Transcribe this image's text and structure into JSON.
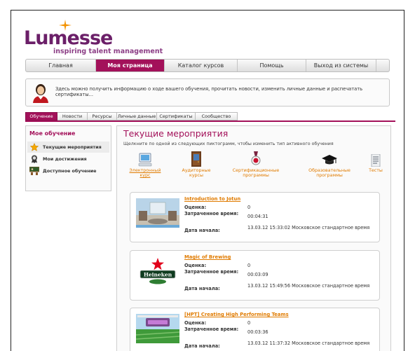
{
  "brand": {
    "name": "Lumesse",
    "tagline": "inspiring talent management",
    "color": "#6b1f68"
  },
  "topnav": [
    {
      "label": "Главная",
      "active": false
    },
    {
      "label": "Моя страница",
      "active": true
    },
    {
      "label": "Каталог курсов",
      "active": false
    },
    {
      "label": "Помощь",
      "active": false
    },
    {
      "label": "Выход из системы",
      "active": false
    }
  ],
  "info": {
    "text": "Здесь можно получить информацию о ходе вашего обучения, прочитать новости, изменить личные данные и распечатать сертификаты..."
  },
  "subtabs": [
    {
      "label": "Обучение",
      "active": true
    },
    {
      "label": "Новости",
      "active": false
    },
    {
      "label": "Ресурсы",
      "active": false
    },
    {
      "label": "Личные данные",
      "active": false
    },
    {
      "label": "Сертификаты",
      "active": false
    },
    {
      "label": "Сообщество",
      "active": false
    }
  ],
  "sidebar": {
    "title": "Мое обучение",
    "items": [
      {
        "label": "Текущие мероприятия",
        "icon": "star-icon",
        "active": true
      },
      {
        "label": "Мои достижения",
        "icon": "medal-icon",
        "active": false
      },
      {
        "label": "Доступное обучение",
        "icon": "classroom-icon",
        "active": false
      }
    ]
  },
  "main": {
    "title": "Текущие мероприятия",
    "subtitle": "Щелкните по одной из следующих пиктограмм, чтобы изменить тип активного обучения",
    "types": [
      {
        "label": "Электронный курс",
        "icon": "computer-icon",
        "active": true
      },
      {
        "label": "Аудиторные курсы",
        "icon": "door-icon",
        "active": false
      },
      {
        "label": "Сертификационные программы",
        "icon": "certificate-icon",
        "active": false
      },
      {
        "label": "Образовательные программы",
        "icon": "graduation-cap-icon",
        "active": false
      },
      {
        "label": "Тесты",
        "icon": "test-sheet-icon",
        "active": false
      }
    ],
    "labels": {
      "score": "Оценка:",
      "time_spent": "Затраченное время:",
      "start_date": "Дата начала:"
    },
    "courses": [
      {
        "title": "Introduction to Jotun",
        "score": "0",
        "time_spent": "00:04:31",
        "start_date": "13.03.12 15:33:02 Московское стандартное время",
        "thumb": "room-thumbnail"
      },
      {
        "title": "Magic of Brewing",
        "score": "0",
        "time_spent": "00:03:09",
        "start_date": "13.03.12 15:49:56 Московское стандартное время",
        "thumb": "heineken-logo",
        "thumb_text": "Heineken"
      },
      {
        "title": "[HPT] Creating High Performing Teams",
        "score": "0",
        "time_spent": "00:03:36",
        "start_date": "13.03.12 11:37:32 Московское стандартное время",
        "thumb": "teams-thumbnail"
      }
    ]
  },
  "colors": {
    "accent": "#a3115a",
    "link": "#e07b00"
  }
}
